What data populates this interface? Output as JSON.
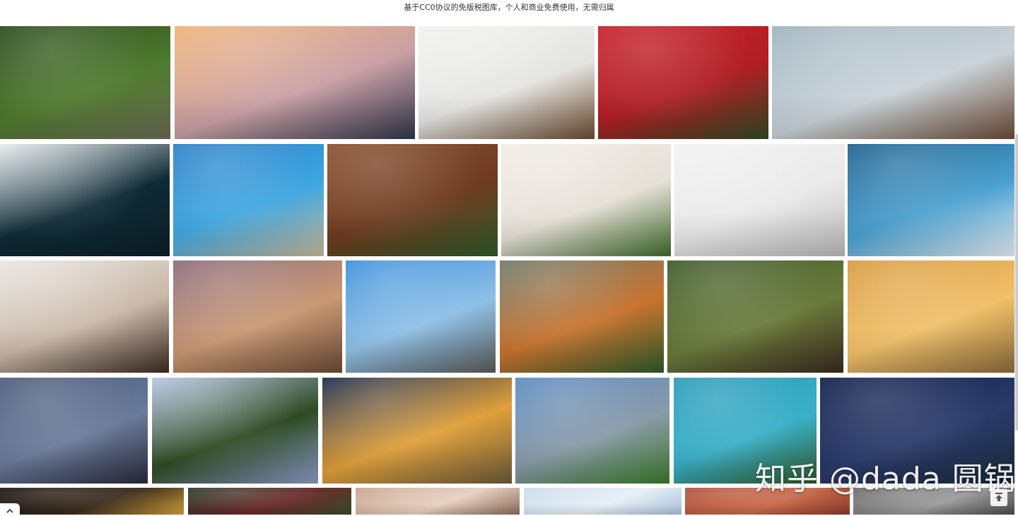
{
  "header": {
    "subtitle": "基于CC0协议的免版税图库，个人和商业免费使用，无需归属"
  },
  "watermark": {
    "text": "知乎 @dada 圆锅"
  },
  "icons": {
    "back_to_top": "arrow-up-to-line-icon",
    "scroll_up": "chevron-up-icon"
  },
  "photos": [
    {
      "name": "railway-forest-photo",
      "colors": [
        "#2b4a1c",
        "#4f7a2e",
        "#6b6a55"
      ]
    },
    {
      "name": "mountain-lake-sunrise-photo",
      "colors": [
        "#f0b27a",
        "#c9a0a5",
        "#2f3548"
      ]
    },
    {
      "name": "christmas-white-wood-photo",
      "colors": [
        "#f2f2f0",
        "#e4e4e2",
        "#6a4a2e"
      ]
    },
    {
      "name": "red-christmas-berries-photo",
      "colors": [
        "#c8202a",
        "#b01e24",
        "#2e4a22"
      ]
    },
    {
      "name": "golden-gate-fog-photo",
      "colors": [
        "#9fb3bf",
        "#c9d3d8",
        "#6b4a36"
      ]
    },
    {
      "name": "mountain-road-night-photo",
      "colors": [
        "#e9eef0",
        "#0f2a35",
        "#0b1f28"
      ]
    },
    {
      "name": "navagio-beach-photo",
      "colors": [
        "#2a7fc8",
        "#3fa7e0",
        "#c8b89a"
      ]
    },
    {
      "name": "wood-pine-cinnamon-photo",
      "colors": [
        "#8a4f2e",
        "#6e3b20",
        "#2e5a2a"
      ]
    },
    {
      "name": "christmas-fir-white-photo",
      "colors": [
        "#f1ece6",
        "#e7e0d8",
        "#3f6a2b"
      ]
    },
    {
      "name": "desk-keyboard-phone-photo",
      "colors": [
        "#f2f2f2",
        "#e9e9e9",
        "#b8b8b8"
      ]
    },
    {
      "name": "blue-sky-clouds-photo",
      "colors": [
        "#1d5f8c",
        "#4aa0cf",
        "#e6eef3"
      ]
    },
    {
      "name": "office-meeting-photo",
      "colors": [
        "#e9e6e1",
        "#c9b8a8",
        "#3a2a22"
      ]
    },
    {
      "name": "beach-rocks-sunset-photo",
      "colors": [
        "#8a6a78",
        "#c99873",
        "#6a4a36"
      ]
    },
    {
      "name": "desert-highway-photo",
      "colors": [
        "#3b8fdc",
        "#8fc0e6",
        "#5a5a58"
      ]
    },
    {
      "name": "tiger-water-photo",
      "colors": [
        "#6e7a6a",
        "#c8732e",
        "#2e5a2a"
      ]
    },
    {
      "name": "pine-forest-path-photo",
      "colors": [
        "#3e5a2a",
        "#6a7a3a",
        "#3a2a1e"
      ]
    },
    {
      "name": "sailing-ship-sunset-photo",
      "colors": [
        "#d89a3e",
        "#f0c06a",
        "#8a6a3a"
      ]
    },
    {
      "name": "city-skyline-dusk-photo",
      "colors": [
        "#4a5a7a",
        "#6a7a9a",
        "#2a2a3a"
      ]
    },
    {
      "name": "lake-reflection-trees-photo",
      "colors": [
        "#b8c8e6",
        "#2e4a22",
        "#8a9ac8"
      ]
    },
    {
      "name": "ocean-sunset-clouds-photo",
      "colors": [
        "#1a2a4a",
        "#e0a03a",
        "#6a5a3a"
      ]
    },
    {
      "name": "alpine-valley-photo",
      "colors": [
        "#5a8ac0",
        "#8a9aa8",
        "#3a7a2a"
      ]
    },
    {
      "name": "christmas-blue-wood-photo",
      "colors": [
        "#2a9ab8",
        "#3ab0c8",
        "#2e5a2a"
      ]
    },
    {
      "name": "milky-way-night-photo",
      "colors": [
        "#0f1f4a",
        "#2a3a6a",
        "#1a2a3a"
      ]
    },
    {
      "name": "sparkler-photo",
      "colors": [
        "#1a1410",
        "#3a2a1a",
        "#d0a03a"
      ]
    },
    {
      "name": "christmas-lights-photo",
      "colors": [
        "#2a3a2a",
        "#6a2a2a",
        "#3a4a2a"
      ]
    },
    {
      "name": "bokeh-lights-photo",
      "colors": [
        "#c8a08a",
        "#e6d0c0",
        "#8a6a5a"
      ]
    },
    {
      "name": "light-sky-photo",
      "colors": [
        "#c8dcec",
        "#e6eef6",
        "#a8c0d8"
      ]
    },
    {
      "name": "brick-wall-photo",
      "colors": [
        "#b0503a",
        "#c86a4a",
        "#8a3a2a"
      ]
    },
    {
      "name": "grey-mist-photo",
      "colors": [
        "#6a6a6a",
        "#9a9a9a",
        "#4a4a4a"
      ]
    }
  ]
}
